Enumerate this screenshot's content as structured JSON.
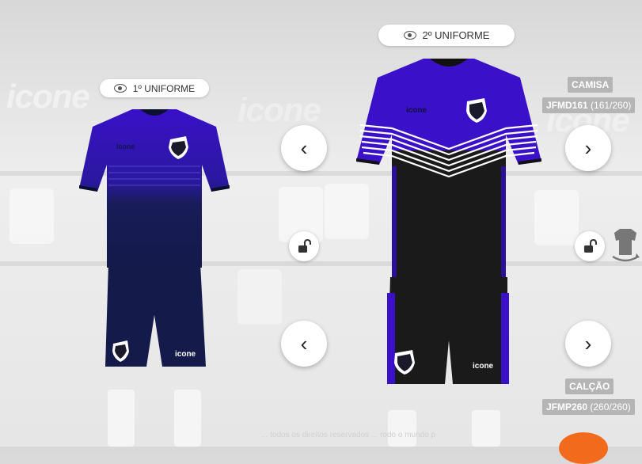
{
  "kit1": {
    "label": "1º UNIFORME",
    "brand": "icone"
  },
  "kit2": {
    "label": "2º UNIFORME",
    "brand": "icone"
  },
  "shirt": {
    "title": "CAMISA",
    "code": "JFMD161",
    "count": "(161/260)"
  },
  "shorts": {
    "title": "CALÇÃO",
    "code": "JFMP260",
    "count": "(260/260)"
  },
  "background": {
    "logo_text": "icone"
  },
  "footer": {
    "text": "... todos os direitos reservados ... rodo o mundo p"
  },
  "colors": {
    "purple": "#3a10c8",
    "navy": "#141a4a",
    "black": "#1a1a1a",
    "stripe": "#ffffff"
  }
}
